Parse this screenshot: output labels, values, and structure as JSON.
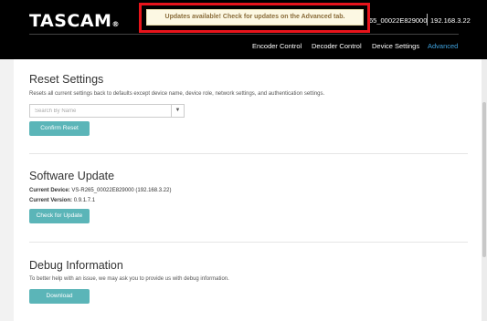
{
  "header": {
    "brand": "TASCAM",
    "brand_mark": "®",
    "device_name": "65_00022E829000",
    "device_ip": "192.168.3.22"
  },
  "notification": {
    "text": "Updates available! Check for updates on the Advanced tab."
  },
  "nav": {
    "items": [
      "Encoder Control",
      "Decoder Control",
      "Device Settings",
      "Advanced"
    ],
    "active": "Advanced"
  },
  "reset": {
    "title": "Reset Settings",
    "description": "Resets all current settings back to defaults except device name, device role, network settings, and authentication settings.",
    "search_placeholder": "Search By Name",
    "dropdown_icon": "caret-down-icon",
    "button": "Confirm Reset"
  },
  "software": {
    "title": "Software Update",
    "device_label": "Current Device:",
    "device_value": "VS-R265_00022E829000 (192.168.3.22)",
    "version_label": "Current Version:",
    "version_value": "0.9.1.7.1",
    "button": "Check for Update"
  },
  "debug": {
    "title": "Debug Information",
    "description": "To better help with an issue, we may ask you to provide us with debug information.",
    "button": "Download"
  },
  "colors": {
    "accent_button": "#5bb5b8",
    "nav_active": "#3fa3e0",
    "highlight_border": "#e8141b",
    "notice_bg": "#fcf8e3"
  }
}
